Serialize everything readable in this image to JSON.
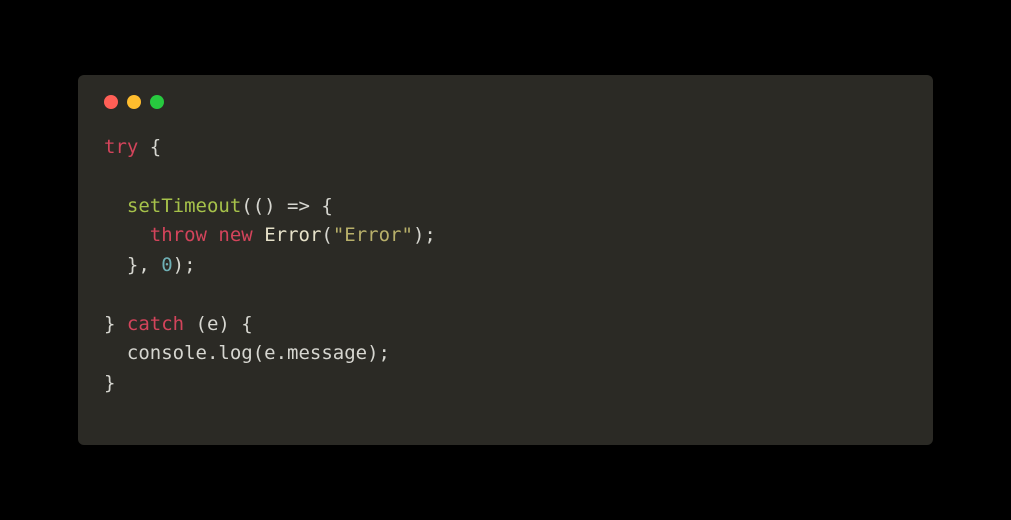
{
  "window": {
    "buttons": [
      "close",
      "minimize",
      "zoom"
    ]
  },
  "code": {
    "tokens": [
      [
        {
          "t": "try",
          "c": "kw"
        },
        {
          "t": " {",
          "c": "punc"
        }
      ],
      [],
      [
        {
          "t": "  ",
          "c": "punc"
        },
        {
          "t": "setTimeout",
          "c": "fn"
        },
        {
          "t": "(() => {",
          "c": "punc"
        }
      ],
      [
        {
          "t": "    ",
          "c": "punc"
        },
        {
          "t": "throw",
          "c": "kw"
        },
        {
          "t": " ",
          "c": "punc"
        },
        {
          "t": "new",
          "c": "kw"
        },
        {
          "t": " ",
          "c": "punc"
        },
        {
          "t": "Error",
          "c": "cls"
        },
        {
          "t": "(",
          "c": "punc"
        },
        {
          "t": "\"Error\"",
          "c": "str"
        },
        {
          "t": ");",
          "c": "punc"
        }
      ],
      [
        {
          "t": "  }, ",
          "c": "punc"
        },
        {
          "t": "0",
          "c": "num"
        },
        {
          "t": ");",
          "c": "punc"
        }
      ],
      [],
      [
        {
          "t": "} ",
          "c": "punc"
        },
        {
          "t": "catch",
          "c": "kw"
        },
        {
          "t": " (e) {",
          "c": "punc"
        }
      ],
      [
        {
          "t": "  console.log(e.message);",
          "c": "punc"
        }
      ],
      [
        {
          "t": "}",
          "c": "punc"
        }
      ]
    ]
  }
}
